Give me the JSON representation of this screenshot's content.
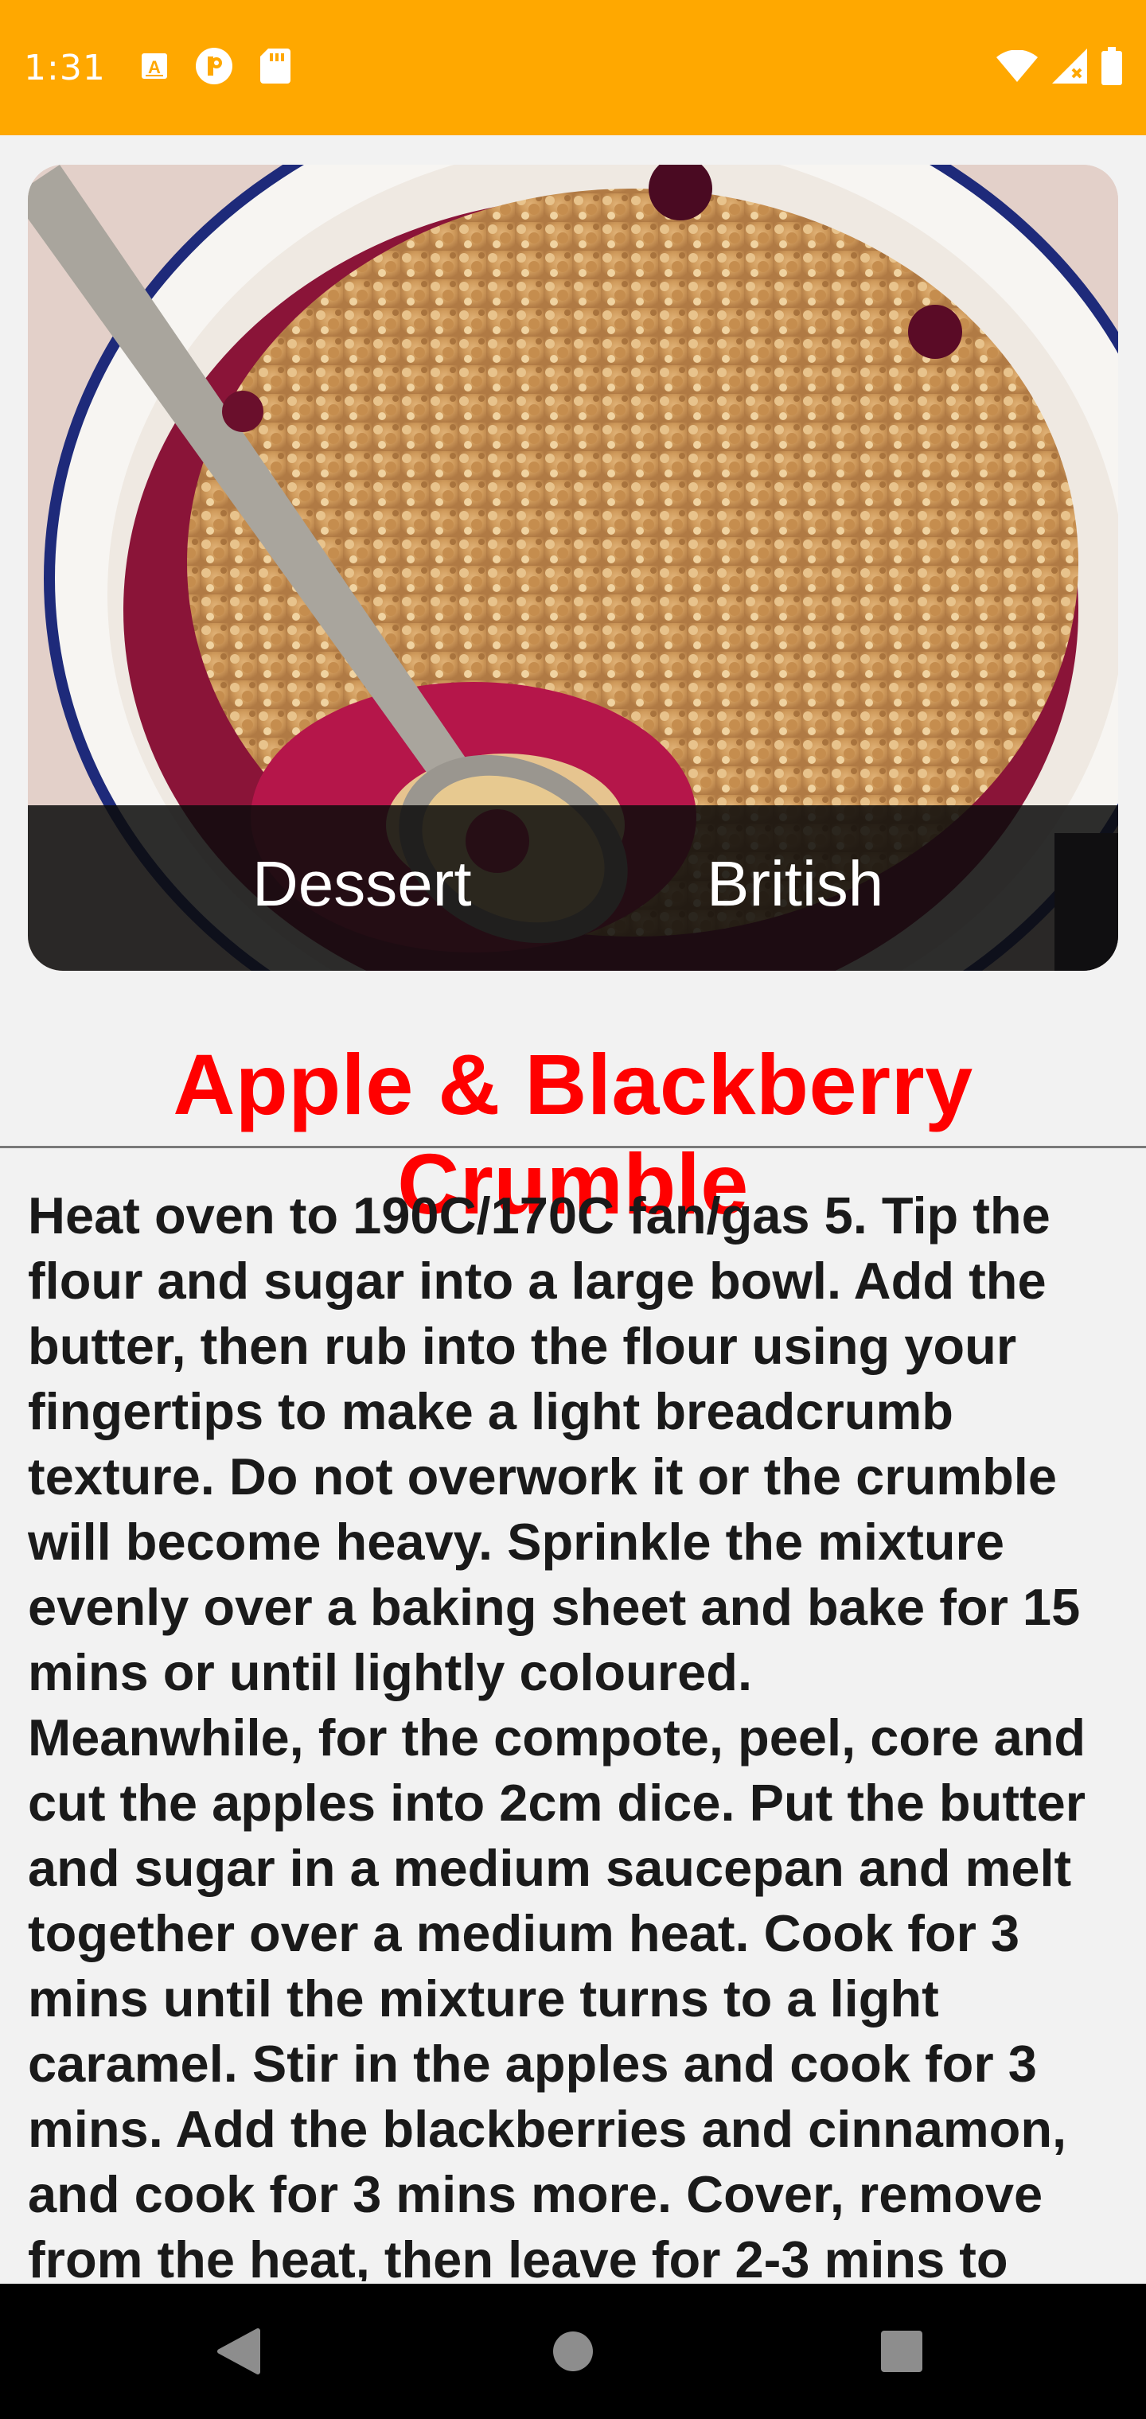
{
  "status_bar": {
    "time": "1:31",
    "left_icons": [
      "keyboard-a-icon",
      "circle-p-icon",
      "sd-card-icon"
    ],
    "right_icons": [
      "wifi-icon",
      "cell-signal-icon",
      "battery-icon"
    ],
    "background_color": "#ffa800"
  },
  "recipe": {
    "image": "apple-blackberry-crumble-photo",
    "category": "Dessert",
    "area": "British",
    "title": "Apple & Blackberry Crumble",
    "title_color": "#ff0000",
    "instructions": "Heat oven to 190C/170C fan/gas 5. Tip the flour and sugar into a large bowl. Add the butter, then rub into the flour using your fingertips to make a light breadcrumb texture. Do not overwork it or the crumble will become heavy. Sprinkle the mixture evenly over a baking sheet and bake for 15 mins or until lightly coloured.\nMeanwhile, for the compote, peel, core and cut the apples into 2cm dice. Put the butter and sugar in a medium saucepan and melt together over a medium heat. Cook for 3 mins until the mixture turns to a light caramel. Stir in the apples and cook for 3 mins. Add the blackberries and cinnamon, and cook for 3 mins more. Cover, remove from the heat, then leave for 2-3 mins to"
  },
  "nav_bar": {
    "buttons": [
      "back-icon",
      "home-icon",
      "recents-icon"
    ]
  }
}
